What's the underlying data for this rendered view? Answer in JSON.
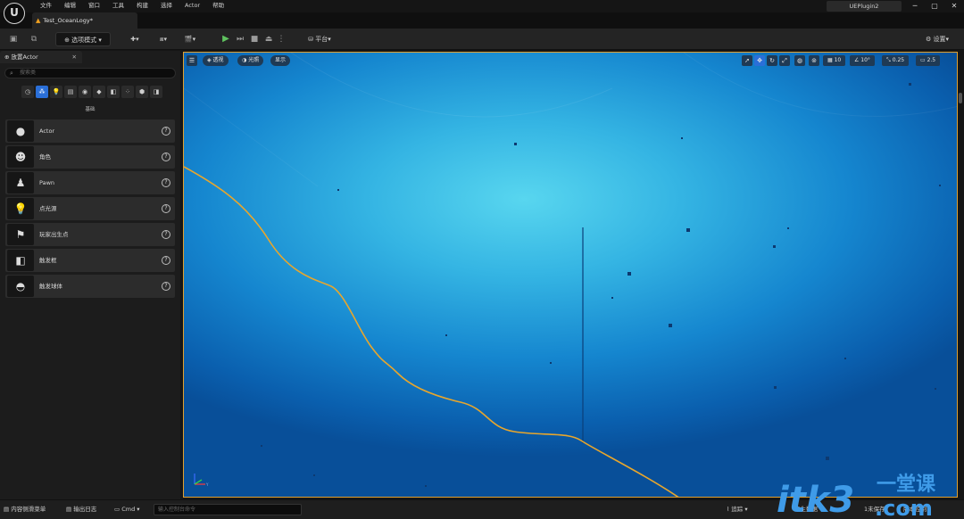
{
  "titlebar": {
    "logo": "U",
    "menu": [
      "文件",
      "编辑",
      "窗口",
      "工具",
      "构建",
      "选择",
      "Actor",
      "帮助"
    ],
    "project": "UEPlugin2",
    "window_buttons": [
      "─",
      "▢",
      "✕"
    ]
  },
  "tabs": {
    "level": "Test_OceanLogy*"
  },
  "toolbar": {
    "mode": "选项模式",
    "platform": "平台",
    "settings": "设置"
  },
  "place_actors": {
    "tab_label": "放置Actor",
    "search_placeholder": "搜索类",
    "category_label": "基础",
    "items": [
      {
        "label": "Actor",
        "icon": "sphere-icon"
      },
      {
        "label": "角色",
        "icon": "character-icon"
      },
      {
        "label": "Pawn",
        "icon": "pawn-icon"
      },
      {
        "label": "点光源",
        "icon": "light-bulb-icon"
      },
      {
        "label": "玩家出生点",
        "icon": "flag-icon"
      },
      {
        "label": "触发框",
        "icon": "cube-icon"
      },
      {
        "label": "触发球体",
        "icon": "sphere-trigger-icon"
      }
    ]
  },
  "viewport": {
    "perspective": "透视",
    "lighting": "光照",
    "show": "显示",
    "grid_snap": "10",
    "rotation_snap": "10°",
    "scale_snap": "0.25",
    "camera_speed": "2.5",
    "colors": {
      "border": "#e0a030",
      "curve": "#e8a62c"
    }
  },
  "bottombar": {
    "content_drawer": "内容侧滑菜单",
    "output_log": "输出日志",
    "cmd": "Cmd",
    "console_placeholder": "输入控制台命令",
    "trace": "追踪",
    "derived_data": "派生数据",
    "unsaved": "1未保存",
    "source_control": "版本控制"
  },
  "watermark": {
    "brand": "itk3",
    "tagline": "一堂课",
    "domain": ".com"
  }
}
